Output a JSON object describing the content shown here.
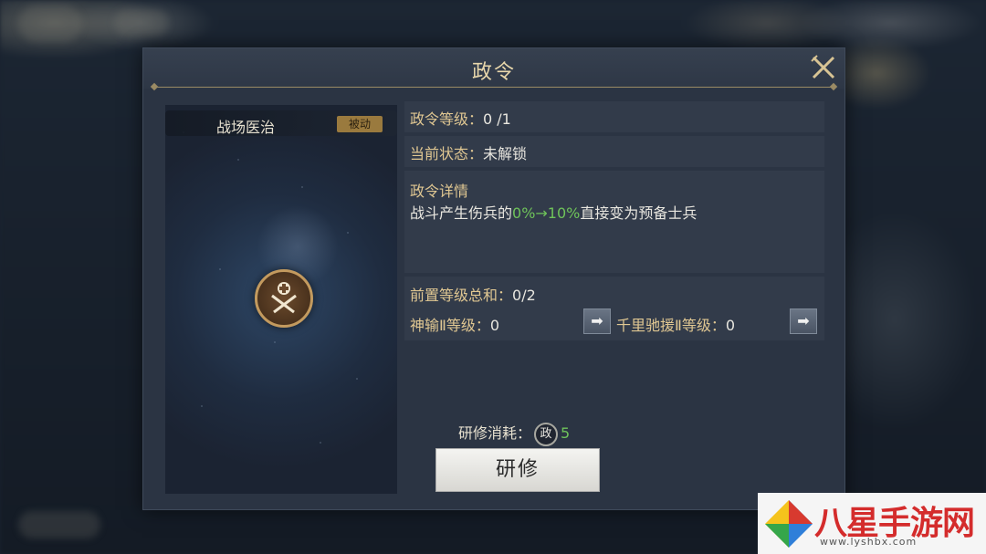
{
  "dialog": {
    "title": "政令",
    "skill_name": "战场医治",
    "skill_type": "被动"
  },
  "info": {
    "level_label": "政令等级：",
    "level_value": "0 /1",
    "status_label": "当前状态：",
    "status_value": "未解锁",
    "details_label": "政令详情",
    "details_prefix": "战斗产生伤兵的",
    "details_highlight": "0%→10%",
    "details_suffix": "直接变为预备士兵",
    "prereq_label": "前置等级总和：",
    "prereq_value": "0/2",
    "prereq_items": [
      {
        "name": "神输Ⅱ等级：",
        "value": "0"
      },
      {
        "name": "千里驰援Ⅱ等级：",
        "value": "0"
      }
    ]
  },
  "cost": {
    "label": "研修消耗：",
    "currency_icon_text": "政",
    "amount": "5"
  },
  "actions": {
    "study_label": "研修"
  },
  "watermark": {
    "text": "八星手游网",
    "url": "www.lyshbx.com"
  },
  "colors": {
    "accent_gold": "#e0c792",
    "highlight_green": "#6fc35a",
    "badge": "#9a7a3e"
  }
}
